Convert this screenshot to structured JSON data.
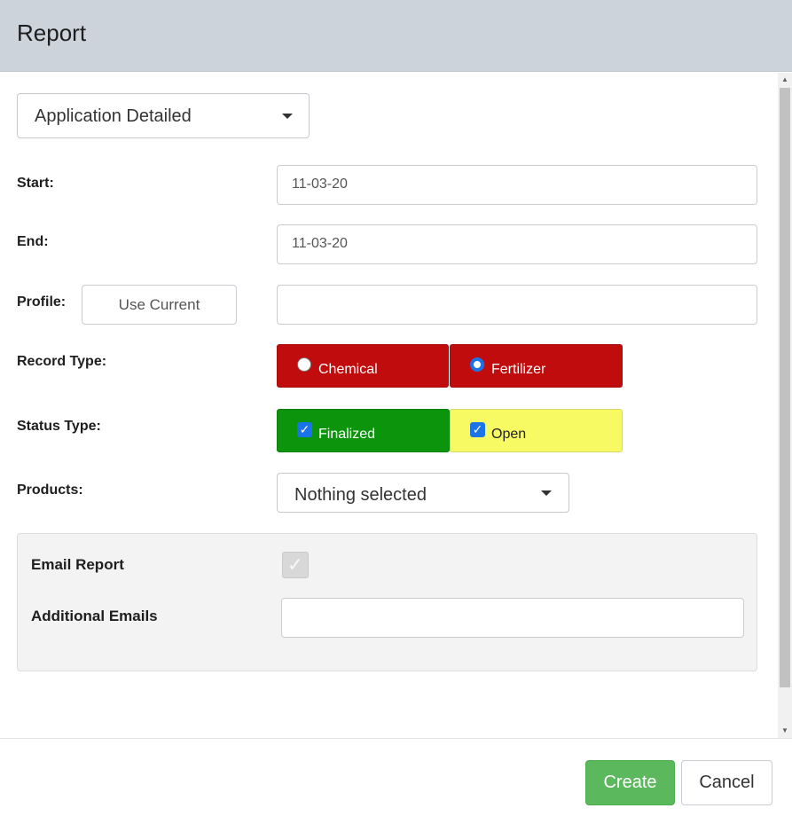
{
  "dialog": {
    "title": "Report"
  },
  "report_select": {
    "value": "Application Detailed"
  },
  "fields": {
    "start": {
      "label": "Start:",
      "value": "11-03-20"
    },
    "end": {
      "label": "End:",
      "value": "11-03-20"
    },
    "profile": {
      "label": "Profile:",
      "use_current_label": "Use Current",
      "value": ""
    },
    "record_type": {
      "label": "Record Type:",
      "options": [
        {
          "label": "Chemical",
          "checked": false,
          "color": "#c00c0c"
        },
        {
          "label": "Fertilizer",
          "checked": true,
          "color": "#c00c0c"
        }
      ]
    },
    "status_type": {
      "label": "Status Type:",
      "options": [
        {
          "label": "Finalized",
          "checked": true,
          "color": "#0c940c"
        },
        {
          "label": "Open",
          "checked": true,
          "color": "#f8fa64"
        }
      ]
    },
    "products": {
      "label": "Products:",
      "value": "Nothing selected"
    }
  },
  "email": {
    "report_label": "Email Report",
    "report_checked": true,
    "additional_label": "Additional Emails",
    "additional_value": ""
  },
  "footer": {
    "create_label": "Create",
    "cancel_label": "Cancel"
  },
  "colors": {
    "header_bg": "#ccd3db",
    "create_bg": "#5cb85c",
    "checkbox_blue": "#1a73e8"
  }
}
